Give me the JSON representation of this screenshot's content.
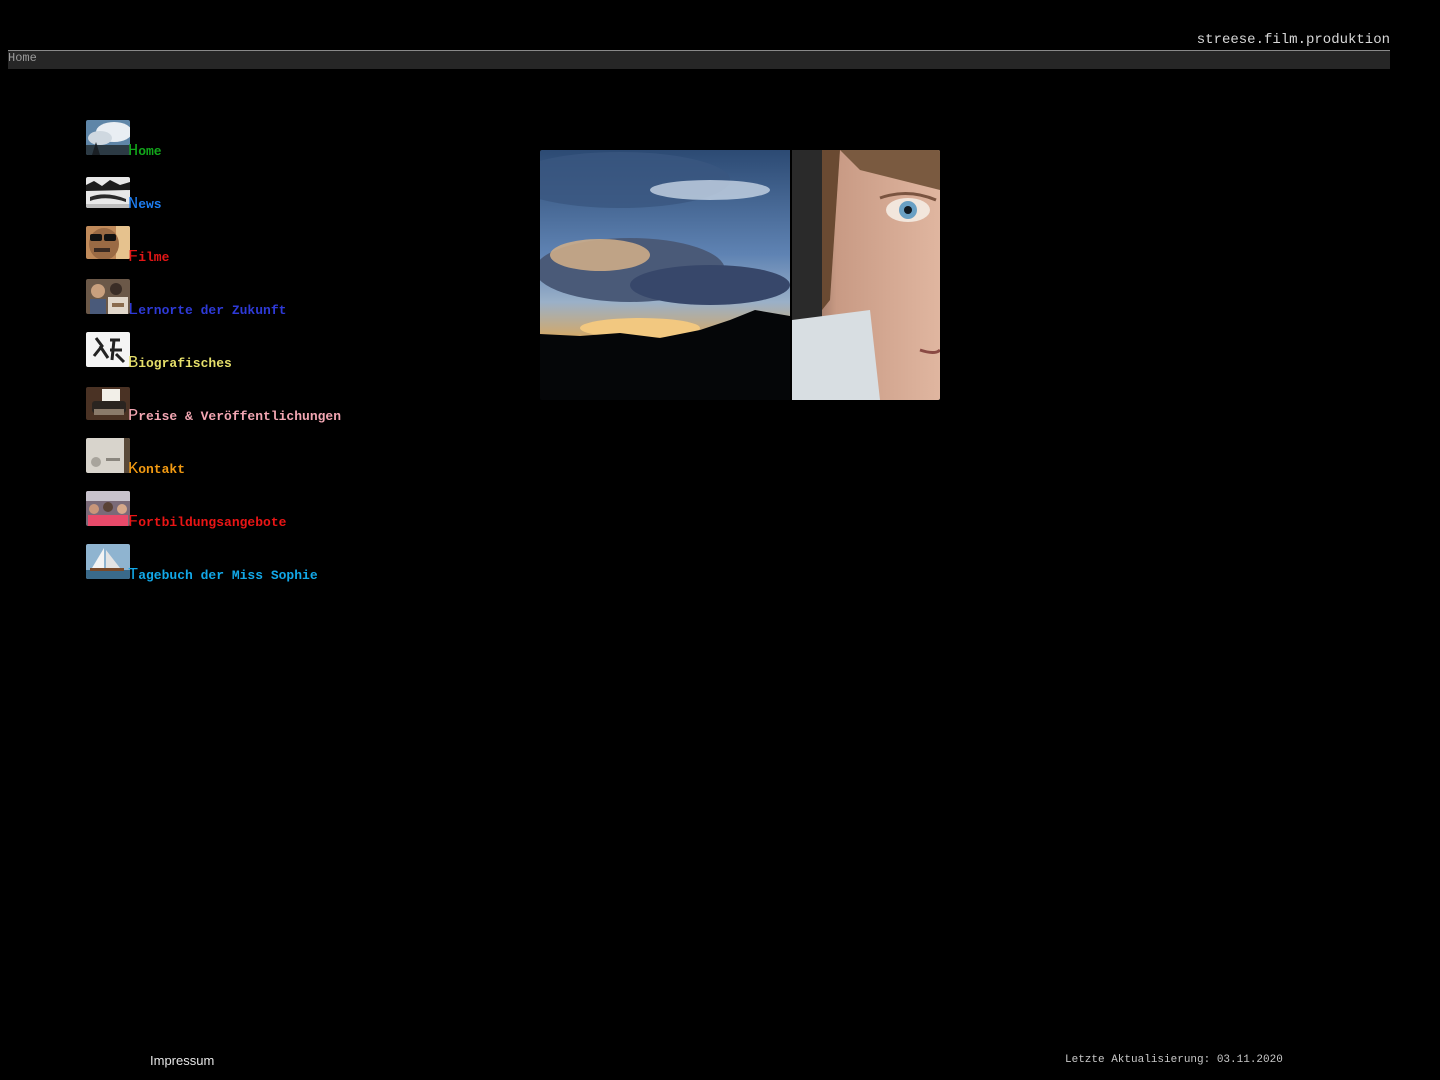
{
  "header": {
    "site_title": "streese.film.produktion",
    "breadcrumb": "Home"
  },
  "nav": [
    {
      "initial": "H",
      "rest": "ome",
      "color": "#12a81b",
      "thumb": "sky-thumbnail"
    },
    {
      "initial": "N",
      "rest": "ews",
      "color": "#1e7ef2",
      "thumb": "landscape-thumbnail"
    },
    {
      "initial": "F",
      "rest": "ilme",
      "color": "#e31616",
      "thumb": "sunglasses-portrait-thumbnail"
    },
    {
      "initial": "L",
      "rest": "ernorte der Zukunft",
      "color": "#2e3ad8",
      "thumb": "students-thumbnail"
    },
    {
      "initial": "B",
      "rest": "iografisches",
      "color": "#e6df6a",
      "thumb": "calligraphy-thumbnail"
    },
    {
      "initial": "P",
      "rest": "reise & Veröffentlichungen",
      "color": "#f2a6b2",
      "thumb": "typewriter-thumbnail"
    },
    {
      "initial": "K",
      "rest": "ontakt",
      "color": "#f29a12",
      "thumb": "desk-thumbnail"
    },
    {
      "initial": "F",
      "rest": "ortbildungsangebote",
      "color": "#ea1515",
      "thumb": "workshop-thumbnail"
    },
    {
      "initial": "T",
      "rest": "agebuch der Miss Sophie",
      "color": "#12a8e8",
      "thumb": "sailboat-thumbnail"
    }
  ],
  "hero": {
    "image": "sunset-sky-and-face-photo"
  },
  "footer": {
    "impressum": "Impressum",
    "last_updated": "Letzte Aktualisierung: 03.11.2020"
  }
}
